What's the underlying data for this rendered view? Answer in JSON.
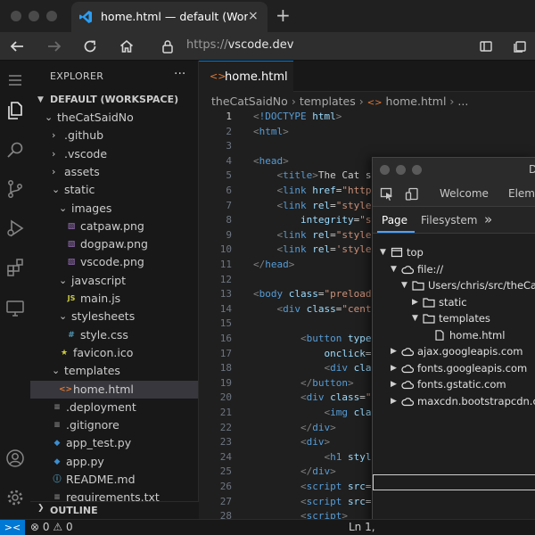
{
  "browser": {
    "tab_title": "home.html — default (Workspace)",
    "close_glyph": "×",
    "new_tab_glyph": "+",
    "url_protocol": "https://",
    "url_host": "vscode.dev"
  },
  "explorer": {
    "header": "EXPLORER",
    "more": "···",
    "workspace": "DEFAULT (WORKSPACE)",
    "items": [
      {
        "label": "theCatSaidNo",
        "kind": "folder-open"
      },
      {
        "label": ".github",
        "kind": "folder"
      },
      {
        "label": ".vscode",
        "kind": "folder"
      },
      {
        "label": "assets",
        "kind": "folder"
      },
      {
        "label": "static",
        "kind": "folder-open"
      },
      {
        "label": "images",
        "kind": "folder-open"
      },
      {
        "label": "catpaw.png",
        "kind": "image"
      },
      {
        "label": "dogpaw.png",
        "kind": "image"
      },
      {
        "label": "vscode.png",
        "kind": "image"
      },
      {
        "label": "javascript",
        "kind": "folder-open"
      },
      {
        "label": "main.js",
        "kind": "js"
      },
      {
        "label": "stylesheets",
        "kind": "folder-open"
      },
      {
        "label": "style.css",
        "kind": "css"
      },
      {
        "label": "favicon.ico",
        "kind": "star"
      },
      {
        "label": "templates",
        "kind": "folder-open"
      },
      {
        "label": "home.html",
        "kind": "html"
      },
      {
        "label": ".deployment",
        "kind": "lines"
      },
      {
        "label": ".gitignore",
        "kind": "lines"
      },
      {
        "label": "app_test.py",
        "kind": "python"
      },
      {
        "label": "app.py",
        "kind": "python"
      },
      {
        "label": "README.md",
        "kind": "info"
      },
      {
        "label": "requirements.txt",
        "kind": "lines"
      }
    ],
    "outline": "OUTLINE"
  },
  "editor": {
    "tab_icon": "<>",
    "tab_label": "home.html",
    "breadcrumb": [
      "theCatSaidNo",
      "templates",
      "home.html",
      "..."
    ],
    "code_lines": [
      [
        [
          "t-br",
          "<"
        ],
        [
          "t-tag",
          "!DOCTYPE"
        ],
        [
          "t-txt",
          " "
        ],
        [
          "t-attr",
          "html"
        ],
        [
          "t-br",
          ">"
        ]
      ],
      [
        [
          "t-br",
          "<"
        ],
        [
          "t-tag",
          "html"
        ],
        [
          "t-br",
          ">"
        ]
      ],
      [],
      [
        [
          "t-br",
          "<"
        ],
        [
          "t-tag",
          "head"
        ],
        [
          "t-br",
          ">"
        ]
      ],
      [
        [
          "t-txt",
          "    "
        ],
        [
          "t-br",
          "<"
        ],
        [
          "t-tag",
          "title"
        ],
        [
          "t-br",
          ">"
        ],
        [
          "t-txt",
          "The Cat s"
        ]
      ],
      [
        [
          "t-txt",
          "    "
        ],
        [
          "t-br",
          "<"
        ],
        [
          "t-tag",
          "link"
        ],
        [
          "t-txt",
          " "
        ],
        [
          "t-attr",
          "href"
        ],
        [
          "t-txt",
          "="
        ],
        [
          "t-str",
          "\"http"
        ]
      ],
      [
        [
          "t-txt",
          "    "
        ],
        [
          "t-br",
          "<"
        ],
        [
          "t-tag",
          "link"
        ],
        [
          "t-txt",
          " "
        ],
        [
          "t-attr",
          "rel"
        ],
        [
          "t-txt",
          "="
        ],
        [
          "t-str",
          "\"style"
        ]
      ],
      [
        [
          "t-txt",
          "        "
        ],
        [
          "t-attr",
          "integrity"
        ],
        [
          "t-txt",
          "="
        ],
        [
          "t-str",
          "\"s"
        ]
      ],
      [
        [
          "t-txt",
          "    "
        ],
        [
          "t-br",
          "<"
        ],
        [
          "t-tag",
          "link"
        ],
        [
          "t-txt",
          " "
        ],
        [
          "t-attr",
          "rel"
        ],
        [
          "t-txt",
          "="
        ],
        [
          "t-str",
          "\"style"
        ]
      ],
      [
        [
          "t-txt",
          "    "
        ],
        [
          "t-br",
          "<"
        ],
        [
          "t-tag",
          "link"
        ],
        [
          "t-txt",
          " "
        ],
        [
          "t-attr",
          "rel"
        ],
        [
          "t-txt",
          "="
        ],
        [
          "t-str",
          "'style"
        ]
      ],
      [
        [
          "t-br",
          "</"
        ],
        [
          "t-tag",
          "head"
        ],
        [
          "t-br",
          ">"
        ]
      ],
      [],
      [
        [
          "t-br",
          "<"
        ],
        [
          "t-tag",
          "body"
        ],
        [
          "t-txt",
          " "
        ],
        [
          "t-attr",
          "class"
        ],
        [
          "t-txt",
          "="
        ],
        [
          "t-str",
          "\"preload"
        ]
      ],
      [
        [
          "t-txt",
          "    "
        ],
        [
          "t-br",
          "<"
        ],
        [
          "t-tag",
          "div"
        ],
        [
          "t-txt",
          " "
        ],
        [
          "t-attr",
          "class"
        ],
        [
          "t-txt",
          "="
        ],
        [
          "t-str",
          "\"cent"
        ]
      ],
      [],
      [
        [
          "t-txt",
          "        "
        ],
        [
          "t-br",
          "<"
        ],
        [
          "t-tag",
          "button"
        ],
        [
          "t-txt",
          " "
        ],
        [
          "t-attr",
          "type"
        ]
      ],
      [
        [
          "t-txt",
          "            "
        ],
        [
          "t-attr",
          "onclick"
        ],
        [
          "t-txt",
          "="
        ]
      ],
      [
        [
          "t-txt",
          "            "
        ],
        [
          "t-br",
          "<"
        ],
        [
          "t-tag",
          "div"
        ],
        [
          "t-txt",
          " "
        ],
        [
          "t-attr",
          "cla"
        ]
      ],
      [
        [
          "t-txt",
          "        "
        ],
        [
          "t-br",
          "</"
        ],
        [
          "t-tag",
          "button"
        ],
        [
          "t-br",
          ">"
        ]
      ],
      [
        [
          "t-txt",
          "        "
        ],
        [
          "t-br",
          "<"
        ],
        [
          "t-tag",
          "div"
        ],
        [
          "t-txt",
          " "
        ],
        [
          "t-attr",
          "class"
        ],
        [
          "t-txt",
          "="
        ],
        [
          "t-str",
          "\""
        ]
      ],
      [
        [
          "t-txt",
          "            "
        ],
        [
          "t-br",
          "<"
        ],
        [
          "t-tag",
          "img"
        ],
        [
          "t-txt",
          " "
        ],
        [
          "t-attr",
          "cla"
        ]
      ],
      [
        [
          "t-txt",
          "        "
        ],
        [
          "t-br",
          "</"
        ],
        [
          "t-tag",
          "div"
        ],
        [
          "t-br",
          ">"
        ]
      ],
      [
        [
          "t-txt",
          "        "
        ],
        [
          "t-br",
          "<"
        ],
        [
          "t-tag",
          "div"
        ],
        [
          "t-br",
          ">"
        ]
      ],
      [
        [
          "t-txt",
          "            "
        ],
        [
          "t-br",
          "<"
        ],
        [
          "t-tag",
          "h1"
        ],
        [
          "t-txt",
          " "
        ],
        [
          "t-attr",
          "styl"
        ]
      ],
      [
        [
          "t-txt",
          "        "
        ],
        [
          "t-br",
          "</"
        ],
        [
          "t-tag",
          "div"
        ],
        [
          "t-br",
          ">"
        ]
      ],
      [
        [
          "t-txt",
          "        "
        ],
        [
          "t-br",
          "<"
        ],
        [
          "t-tag",
          "script"
        ],
        [
          "t-txt",
          " "
        ],
        [
          "t-attr",
          "src"
        ],
        [
          "t-txt",
          "="
        ]
      ],
      [
        [
          "t-txt",
          "        "
        ],
        [
          "t-br",
          "<"
        ],
        [
          "t-tag",
          "script"
        ],
        [
          "t-txt",
          " "
        ],
        [
          "t-attr",
          "src"
        ],
        [
          "t-txt",
          "="
        ]
      ],
      [
        [
          "t-txt",
          "        "
        ],
        [
          "t-br",
          "<"
        ],
        [
          "t-tag",
          "script"
        ],
        [
          "t-br",
          ">"
        ]
      ]
    ]
  },
  "devtools": {
    "tabs": [
      "Welcome",
      "Eleme"
    ],
    "title_initial": "D",
    "subtabs": [
      "Page",
      "Filesystem"
    ],
    "overflow": "»",
    "tree": [
      {
        "label": "top",
        "icon": "frame",
        "arrow": "down"
      },
      {
        "label": "file://",
        "icon": "cloud",
        "arrow": "down"
      },
      {
        "label": "Users/chris/src/theCatSa",
        "icon": "folder",
        "arrow": "down"
      },
      {
        "label": "static",
        "icon": "folder",
        "arrow": "right"
      },
      {
        "label": "templates",
        "icon": "folder",
        "arrow": "down"
      },
      {
        "label": "home.html",
        "icon": "file",
        "arrow": ""
      },
      {
        "label": "ajax.googleapis.com",
        "icon": "cloud",
        "arrow": "right"
      },
      {
        "label": "fonts.googleapis.com",
        "icon": "cloud",
        "arrow": "right"
      },
      {
        "label": "fonts.gstatic.com",
        "icon": "cloud",
        "arrow": "right"
      },
      {
        "label": "maxcdn.bootstrapcdn.com",
        "icon": "cloud",
        "arrow": "right"
      }
    ]
  },
  "status": {
    "remote": "><",
    "errors": "0",
    "warnings": "0",
    "position": "Ln 1,"
  }
}
